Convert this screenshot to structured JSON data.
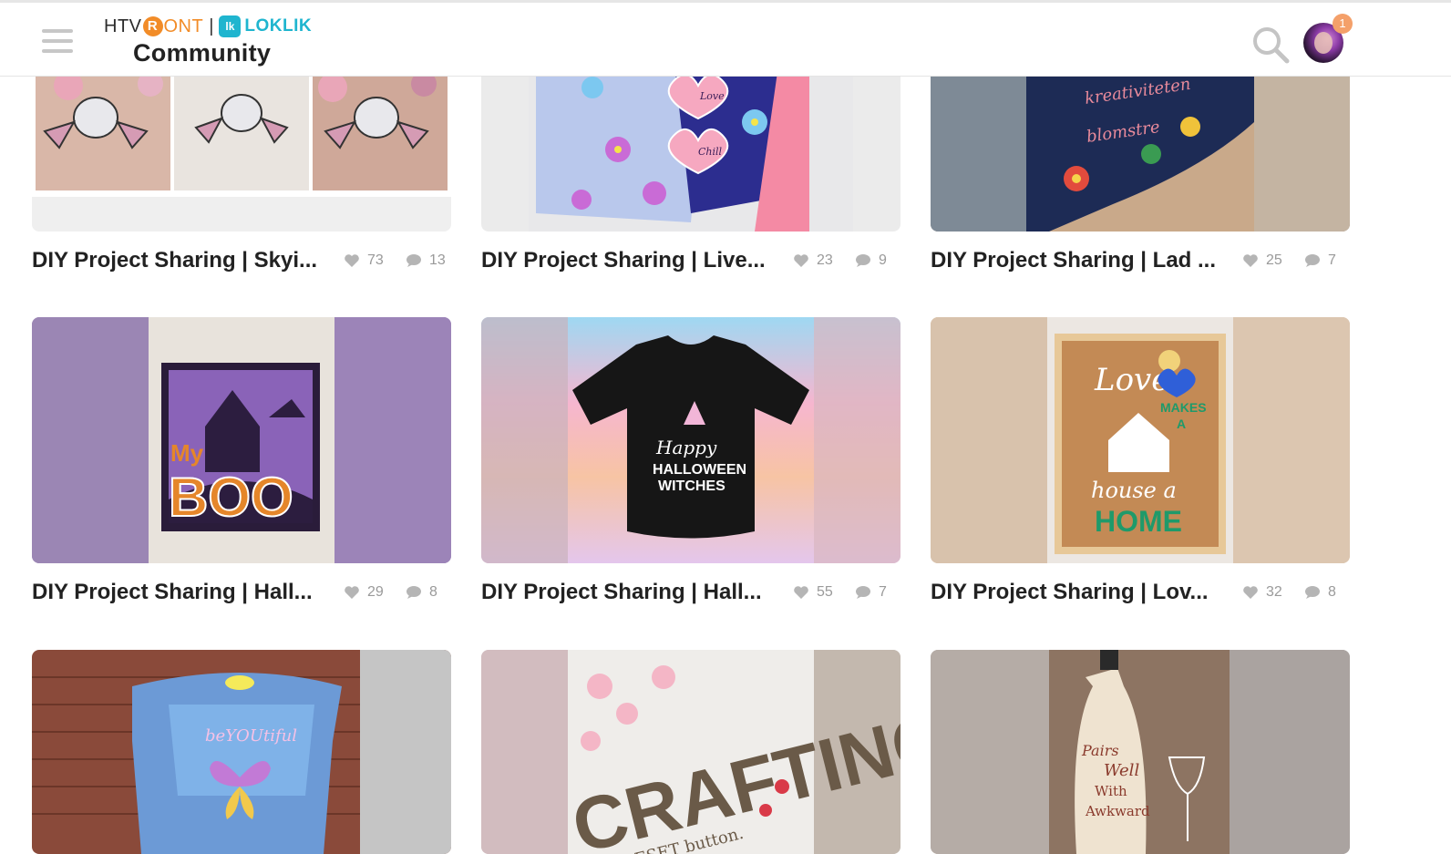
{
  "header": {
    "brand_htv": "HTV",
    "brand_r": "R",
    "brand_ont": "ONT",
    "brand_sep": "|",
    "brand_lk": "lk",
    "brand_loklik": "LOKLIK",
    "brand_community": "Community",
    "notification_count": "1",
    "icons": {
      "menu": "hamburger-menu-icon",
      "search": "search-icon",
      "avatar": "user-avatar"
    }
  },
  "colors": {
    "accent_orange": "#f28c28",
    "accent_teal": "#1fb5cf",
    "badge": "#f4a06a",
    "stat_gray": "#9a9a9a"
  },
  "posts": [
    {
      "title": "DIY Project Sharing | Skyi...",
      "likes": "73",
      "comments": "13"
    },
    {
      "title": "DIY Project Sharing | Live...",
      "likes": "23",
      "comments": "9"
    },
    {
      "title": "DIY Project Sharing | Lad ...",
      "likes": "25",
      "comments": "7"
    },
    {
      "title": "DIY Project Sharing | Hall...",
      "likes": "29",
      "comments": "8"
    },
    {
      "title": "DIY Project Sharing | Hall...",
      "likes": "55",
      "comments": "7"
    },
    {
      "title": "DIY Project Sharing | Lov...",
      "likes": "32",
      "comments": "8"
    }
  ],
  "images": {
    "bat_card_caption": "",
    "card_love": "Love",
    "card_chill": "Chill",
    "bag_line1": "kreativiteten",
    "bag_line2": "blomstre",
    "boo_my": "My",
    "boo_word": "BOO",
    "shirt_line1": "Happy",
    "shirt_line2": "HALLOWEEN",
    "shirt_line3": "WITCHES",
    "board_love": "Love",
    "board_makes": "MAKES",
    "board_a": "A",
    "board_house": "house a",
    "board_home": "HOME",
    "dress_text": "beYOUtiful",
    "crafting_word": "CRAFTING",
    "crafting_sub": "RESET button.",
    "bottle_line1": "Pairs",
    "bottle_line2": "Well",
    "bottle_line3": "With",
    "bottle_line4": "Awkward"
  }
}
